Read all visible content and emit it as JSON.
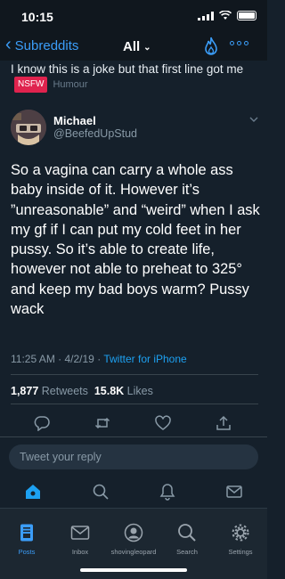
{
  "status_bar": {
    "time": "10:15"
  },
  "nav": {
    "back_label": "Subreddits",
    "feed_label": "All"
  },
  "post": {
    "title": "I know this is a joke but that first line got me",
    "nsfw_tag": "NSFW",
    "flair": "Humour"
  },
  "tweet": {
    "author_name": "Michael",
    "author_handle": "@BeefedUpStud",
    "body": "So a vagina can carry a whole ass baby inside of it. However it’s ”unreasonable” and “weird” when I ask my gf if I can put my cold feet in her pussy. So it’s able to create life, however not able to preheat to 325° and keep my bad boys warm? Pussy wack",
    "time": "11:25 AM",
    "date": "4/2/19",
    "source": "Twitter for iPhone",
    "retweets": "1,877",
    "retweets_label": "Retweets",
    "likes": "15.8K",
    "likes_label": "Likes",
    "reply_placeholder": "Tweet your reply"
  },
  "tabbar": {
    "items": [
      {
        "label": "Posts",
        "icon": "posts-icon"
      },
      {
        "label": "Inbox",
        "icon": "inbox-icon"
      },
      {
        "label": "shovingleopard",
        "icon": "profile-icon"
      },
      {
        "label": "Search",
        "icon": "search-icon"
      },
      {
        "label": "Settings",
        "icon": "settings-icon"
      }
    ]
  },
  "colors": {
    "accent": "#3b9df8",
    "twitter_blue": "#1da1f2",
    "nsfw": "#e0234e",
    "background": "#15202b"
  }
}
